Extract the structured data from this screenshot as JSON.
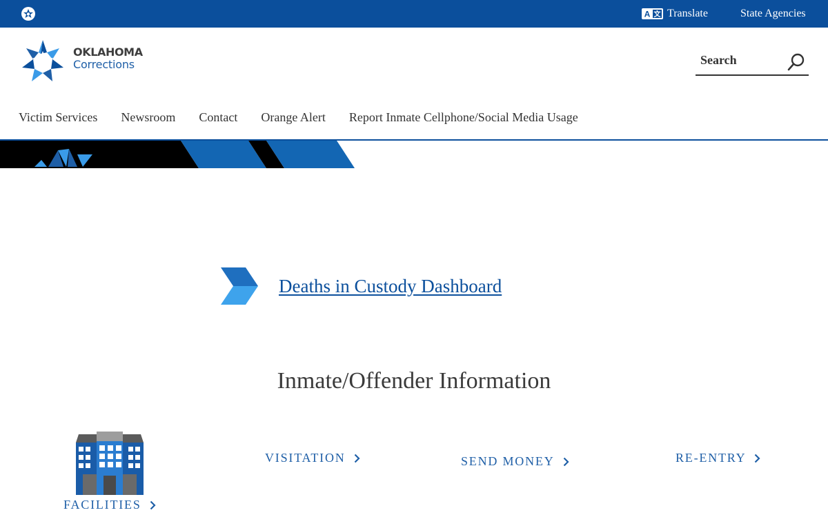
{
  "topbar": {
    "translate_label": "Translate",
    "agencies_label": "State Agencies",
    "translate_icon": "translate-icon",
    "logo_icon": "oklahoma-star-icon"
  },
  "header": {
    "logo_line1": "OKLAHOMA",
    "logo_line2": "Corrections",
    "search_placeholder": "Search"
  },
  "nav": {
    "items": [
      {
        "label": "Victim Services"
      },
      {
        "label": "Newsroom"
      },
      {
        "label": "Contact"
      },
      {
        "label": "Orange Alert"
      },
      {
        "label": "Report Inmate Cellphone/Social Media Usage"
      }
    ]
  },
  "main": {
    "deaths_link": "Deaths in Custody Dashboard",
    "section_title": "Inmate/Offender Information",
    "links": {
      "facilities": "FACILITIES",
      "visitation": "VISITATION",
      "send_money": "SEND MONEY",
      "reentry": "RE-ENTRY"
    }
  },
  "colors": {
    "brand_blue": "#0b4f9c",
    "accent_blue": "#1f5fa7",
    "light_blue": "#3a9be8"
  }
}
